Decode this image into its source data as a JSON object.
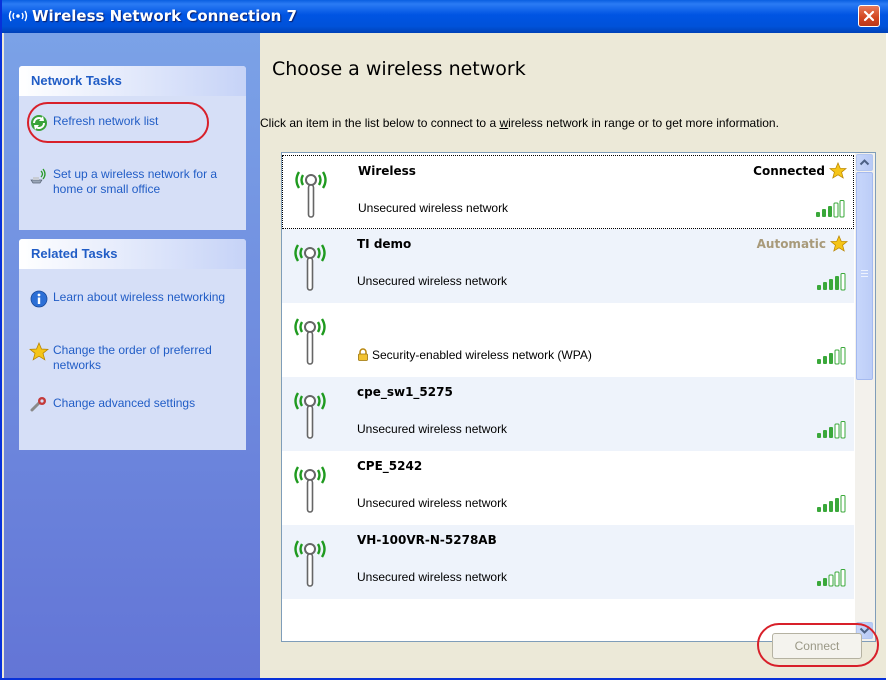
{
  "window": {
    "title": "Wireless Network Connection 7"
  },
  "sidebar": {
    "network_tasks": {
      "title": "Network Tasks",
      "items": [
        {
          "label": "Refresh network list",
          "icon": "refresh-icon"
        },
        {
          "label": "Set up a wireless network for a home or small office",
          "icon": "wireless-setup-icon"
        }
      ]
    },
    "related_tasks": {
      "title": "Related Tasks",
      "items": [
        {
          "label": "Learn about wireless networking",
          "icon": "info-icon"
        },
        {
          "label": "Change the order of preferred networks",
          "icon": "star-icon"
        },
        {
          "label": "Change advanced settings",
          "icon": "settings-icon"
        }
      ]
    }
  },
  "main": {
    "heading": "Choose a wireless network",
    "instructions_pre": "Click an item in the list below to connect to a ",
    "instructions_link": "w",
    "instructions_post": "ireless network in range or to get more information.",
    "networks": [
      {
        "name": "Wireless",
        "status": "Connected",
        "description": "Unsecured wireless network",
        "secured": false,
        "starred": true
      },
      {
        "name": "TI demo",
        "status": "Automatic",
        "description": "Unsecured wireless network",
        "secured": false,
        "starred": true
      },
      {
        "name": "",
        "status": "",
        "description": "Security-enabled wireless network (WPA)",
        "secured": true,
        "starred": false
      },
      {
        "name": "cpe_sw1_5275",
        "status": "",
        "description": "Unsecured wireless network",
        "secured": false,
        "starred": false
      },
      {
        "name": "CPE_5242",
        "status": "",
        "description": "Unsecured wireless network",
        "secured": false,
        "starred": false
      },
      {
        "name": "VH-100VR-N-5278AB",
        "status": "",
        "description": "Unsecured wireless network",
        "secured": false,
        "starred": false
      }
    ],
    "connect_label": "Connect"
  },
  "colors": {
    "title_bar": "#0054e3",
    "task_link": "#215dc6",
    "highlight": "#d8202a",
    "automatic": "#a89a7a"
  }
}
